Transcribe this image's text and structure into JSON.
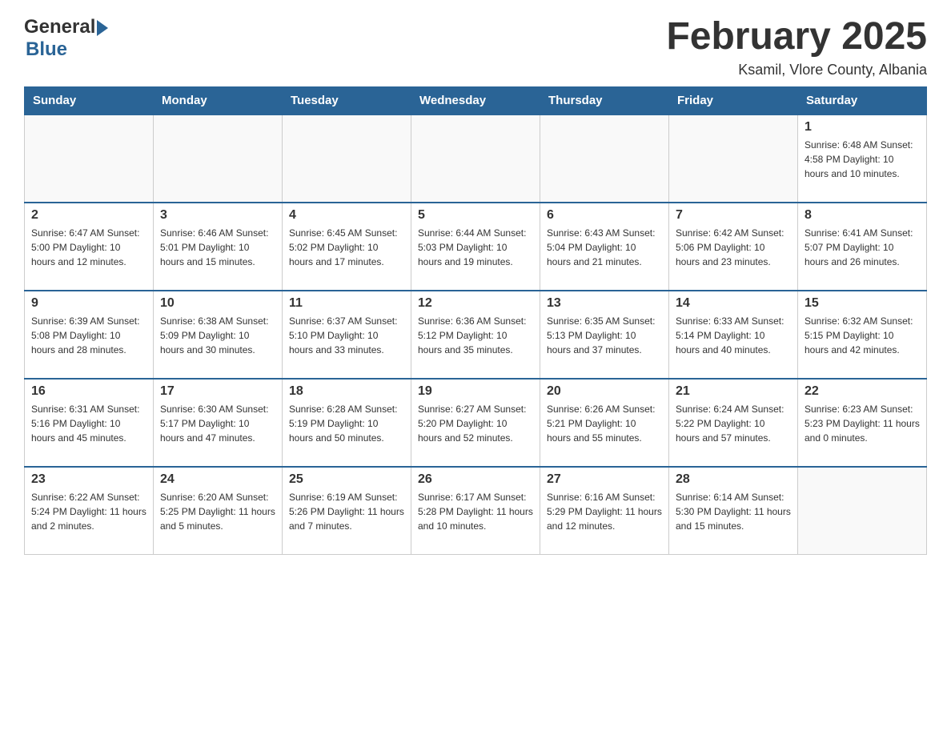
{
  "header": {
    "logo_general": "General",
    "logo_blue": "Blue",
    "title": "February 2025",
    "subtitle": "Ksamil, Vlore County, Albania"
  },
  "days_of_week": [
    "Sunday",
    "Monday",
    "Tuesday",
    "Wednesday",
    "Thursday",
    "Friday",
    "Saturday"
  ],
  "weeks": [
    [
      {
        "day": "",
        "info": ""
      },
      {
        "day": "",
        "info": ""
      },
      {
        "day": "",
        "info": ""
      },
      {
        "day": "",
        "info": ""
      },
      {
        "day": "",
        "info": ""
      },
      {
        "day": "",
        "info": ""
      },
      {
        "day": "1",
        "info": "Sunrise: 6:48 AM\nSunset: 4:58 PM\nDaylight: 10 hours\nand 10 minutes."
      }
    ],
    [
      {
        "day": "2",
        "info": "Sunrise: 6:47 AM\nSunset: 5:00 PM\nDaylight: 10 hours\nand 12 minutes."
      },
      {
        "day": "3",
        "info": "Sunrise: 6:46 AM\nSunset: 5:01 PM\nDaylight: 10 hours\nand 15 minutes."
      },
      {
        "day": "4",
        "info": "Sunrise: 6:45 AM\nSunset: 5:02 PM\nDaylight: 10 hours\nand 17 minutes."
      },
      {
        "day": "5",
        "info": "Sunrise: 6:44 AM\nSunset: 5:03 PM\nDaylight: 10 hours\nand 19 minutes."
      },
      {
        "day": "6",
        "info": "Sunrise: 6:43 AM\nSunset: 5:04 PM\nDaylight: 10 hours\nand 21 minutes."
      },
      {
        "day": "7",
        "info": "Sunrise: 6:42 AM\nSunset: 5:06 PM\nDaylight: 10 hours\nand 23 minutes."
      },
      {
        "day": "8",
        "info": "Sunrise: 6:41 AM\nSunset: 5:07 PM\nDaylight: 10 hours\nand 26 minutes."
      }
    ],
    [
      {
        "day": "9",
        "info": "Sunrise: 6:39 AM\nSunset: 5:08 PM\nDaylight: 10 hours\nand 28 minutes."
      },
      {
        "day": "10",
        "info": "Sunrise: 6:38 AM\nSunset: 5:09 PM\nDaylight: 10 hours\nand 30 minutes."
      },
      {
        "day": "11",
        "info": "Sunrise: 6:37 AM\nSunset: 5:10 PM\nDaylight: 10 hours\nand 33 minutes."
      },
      {
        "day": "12",
        "info": "Sunrise: 6:36 AM\nSunset: 5:12 PM\nDaylight: 10 hours\nand 35 minutes."
      },
      {
        "day": "13",
        "info": "Sunrise: 6:35 AM\nSunset: 5:13 PM\nDaylight: 10 hours\nand 37 minutes."
      },
      {
        "day": "14",
        "info": "Sunrise: 6:33 AM\nSunset: 5:14 PM\nDaylight: 10 hours\nand 40 minutes."
      },
      {
        "day": "15",
        "info": "Sunrise: 6:32 AM\nSunset: 5:15 PM\nDaylight: 10 hours\nand 42 minutes."
      }
    ],
    [
      {
        "day": "16",
        "info": "Sunrise: 6:31 AM\nSunset: 5:16 PM\nDaylight: 10 hours\nand 45 minutes."
      },
      {
        "day": "17",
        "info": "Sunrise: 6:30 AM\nSunset: 5:17 PM\nDaylight: 10 hours\nand 47 minutes."
      },
      {
        "day": "18",
        "info": "Sunrise: 6:28 AM\nSunset: 5:19 PM\nDaylight: 10 hours\nand 50 minutes."
      },
      {
        "day": "19",
        "info": "Sunrise: 6:27 AM\nSunset: 5:20 PM\nDaylight: 10 hours\nand 52 minutes."
      },
      {
        "day": "20",
        "info": "Sunrise: 6:26 AM\nSunset: 5:21 PM\nDaylight: 10 hours\nand 55 minutes."
      },
      {
        "day": "21",
        "info": "Sunrise: 6:24 AM\nSunset: 5:22 PM\nDaylight: 10 hours\nand 57 minutes."
      },
      {
        "day": "22",
        "info": "Sunrise: 6:23 AM\nSunset: 5:23 PM\nDaylight: 11 hours\nand 0 minutes."
      }
    ],
    [
      {
        "day": "23",
        "info": "Sunrise: 6:22 AM\nSunset: 5:24 PM\nDaylight: 11 hours\nand 2 minutes."
      },
      {
        "day": "24",
        "info": "Sunrise: 6:20 AM\nSunset: 5:25 PM\nDaylight: 11 hours\nand 5 minutes."
      },
      {
        "day": "25",
        "info": "Sunrise: 6:19 AM\nSunset: 5:26 PM\nDaylight: 11 hours\nand 7 minutes."
      },
      {
        "day": "26",
        "info": "Sunrise: 6:17 AM\nSunset: 5:28 PM\nDaylight: 11 hours\nand 10 minutes."
      },
      {
        "day": "27",
        "info": "Sunrise: 6:16 AM\nSunset: 5:29 PM\nDaylight: 11 hours\nand 12 minutes."
      },
      {
        "day": "28",
        "info": "Sunrise: 6:14 AM\nSunset: 5:30 PM\nDaylight: 11 hours\nand 15 minutes."
      },
      {
        "day": "",
        "info": ""
      }
    ]
  ]
}
